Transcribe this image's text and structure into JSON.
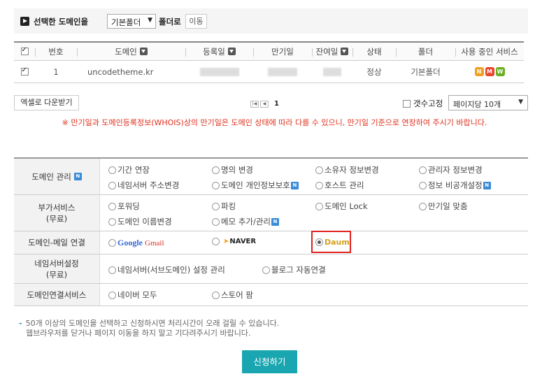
{
  "top_bar": {
    "label_before": "선택한 도메인을",
    "folder_select_value": "기본폴더",
    "label_after": "폴더로",
    "move_button": "이동"
  },
  "domain_table": {
    "headers": {
      "no": "번호",
      "domain": "도메인",
      "reg_date": "등록일",
      "exp_date": "만기일",
      "remaining": "잔여일",
      "status": "상태",
      "folder": "폴더",
      "services": "사용 중인 서비스"
    },
    "rows": [
      {
        "checked": true,
        "no": "1",
        "domain": "uncodetheme.kr",
        "status": "정상",
        "folder": "기본폴더",
        "services": [
          "N",
          "M",
          "W"
        ]
      }
    ]
  },
  "service_colors": {
    "N": "#f0a020",
    "M": "#e8452c",
    "W": "#6ab023"
  },
  "toolbar": {
    "excel_button": "엑셀로 다운받기",
    "current_page": "1",
    "fix_count_label": "갯수고정",
    "per_page_value": "페이지당 10개"
  },
  "notice": "※ 만기일과 도메인등록정보(WHOIS)상의 만기일은 도메인 상태에 따라 다를 수 있으니, 만기일 기준으로 연장하여 주시기 바랍니다.",
  "services": {
    "domain_mgmt": {
      "label": "도메인 관리",
      "options": [
        "기간 연장",
        "명의 변경",
        "소유자 정보변경",
        "관리자 정보변경",
        "네임서버 주소변경",
        "도메인 개인정보보호",
        "호스트 관리",
        "정보 비공개설정"
      ]
    },
    "extra": {
      "label_line1": "부가서비스",
      "label_line2": "(무료)",
      "options": [
        "포워딩",
        "파킹",
        "도메인 Lock",
        "만기일 맞춤",
        "도메인 이름변경",
        "메모 추가/관리"
      ]
    },
    "mail": {
      "label": "도메인-메일 연결",
      "options": [
        "Google",
        "Gmail",
        "NAVER",
        "Daum"
      ]
    },
    "nameserver": {
      "label_line1": "네임서버설정",
      "label_line2": "(무료)",
      "options": [
        "네임서버(서브도메인) 설정 관리",
        "블로그 자동연결"
      ]
    },
    "connect": {
      "label": "도메인연결서비스",
      "options": [
        "네이버 모두",
        "스토어 팜"
      ]
    }
  },
  "footer_note": {
    "line1": "50개 이상의 도메인을 선택하고 신청하시면 처리시간이 오래 걸릴 수 있습니다.",
    "line2": "웹브라우저를 닫거나 페이지 이동을 하지 말고 기다려주시기 바랍니다."
  },
  "apply_button": "신청하기"
}
